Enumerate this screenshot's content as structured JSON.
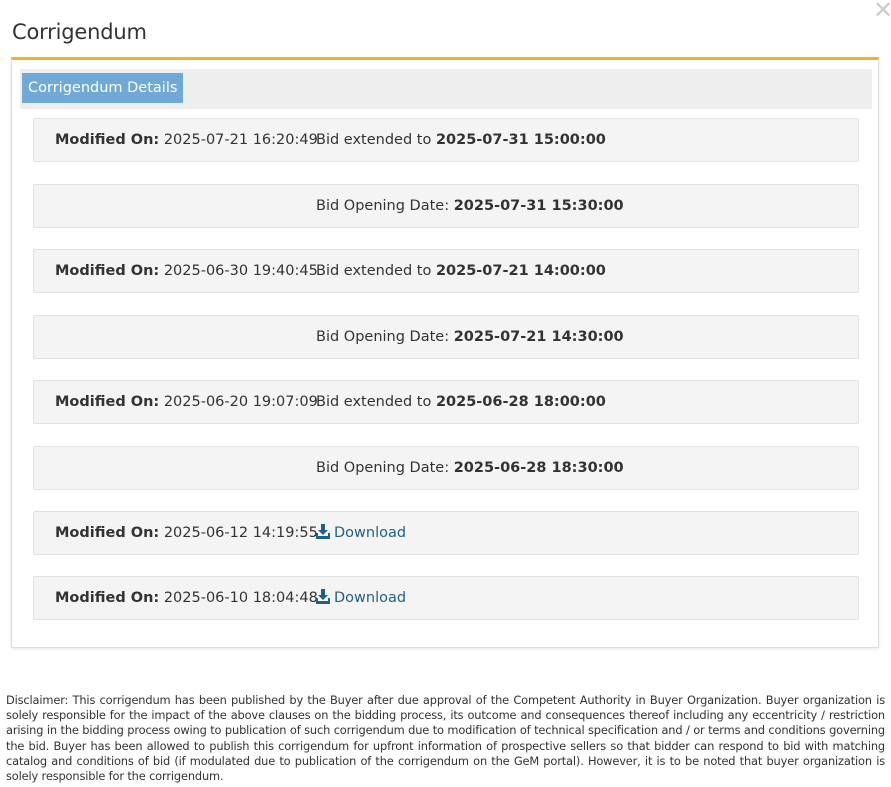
{
  "modal": {
    "title": "Corrigendum",
    "close_symbol": "✕",
    "close_icon": "close-icon"
  },
  "panel": {
    "tab_label": "Corrigendum Details",
    "accent_color": "#f0b323",
    "tab_color": "#6fa9d6"
  },
  "rows": [
    {
      "modified_label": "Modified On:",
      "modified_value": "2025-07-21 16:20:49",
      "text_prefix": "Bid extended to",
      "text_value": "2025-07-31 15:00:00"
    },
    {
      "modified_label": "",
      "modified_value": "",
      "text_prefix": "Bid Opening Date:",
      "text_value": "2025-07-31 15:30:00"
    },
    {
      "modified_label": "Modified On:",
      "modified_value": "2025-06-30 19:40:45",
      "text_prefix": "Bid extended to",
      "text_value": "2025-07-21 14:00:00"
    },
    {
      "modified_label": "",
      "modified_value": "",
      "text_prefix": "Bid Opening Date:",
      "text_value": "2025-07-21 14:30:00"
    },
    {
      "modified_label": "Modified On:",
      "modified_value": "2025-06-20 19:07:09",
      "text_prefix": "Bid extended to",
      "text_value": "2025-06-28 18:00:00"
    },
    {
      "modified_label": "",
      "modified_value": "",
      "text_prefix": "Bid Opening Date:",
      "text_value": "2025-06-28 18:30:00"
    },
    {
      "modified_label": "Modified On:",
      "modified_value": "2025-06-12 14:19:55",
      "download_label": "Download",
      "download_icon": "download-icon"
    },
    {
      "modified_label": "Modified On:",
      "modified_value": "2025-06-10 18:04:48",
      "download_label": "Download",
      "download_icon": "download-icon"
    }
  ],
  "disclaimer": "Disclaimer: This corrigendum has been published by the Buyer after due approval of the Competent Authority in Buyer Organization. Buyer organization is solely responsible for the impact of the above clauses on the bidding process, its outcome and consequences thereof including any eccentricity / restriction arising in the bidding process owing to publication of such corrigendum due to modification of technical specification and / or terms and conditions governing the bid. Buyer has been allowed to publish this corrigendum for upfront information of prospective sellers so that bidder can respond to bid with matching catalog and conditions of bid (if modulated due to publication of the corrigendum on the GeM portal). However, it is to be noted that buyer organization is solely responsible for the corrigendum."
}
